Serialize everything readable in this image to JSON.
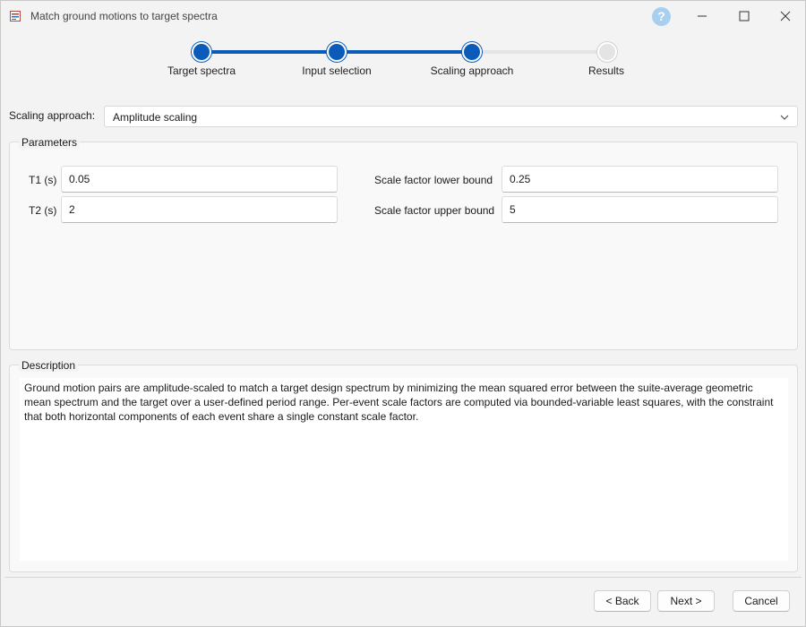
{
  "window": {
    "title": "Match ground motions to target spectra"
  },
  "titlebar": {
    "help_glyph": "?",
    "icons": [
      "app-icon",
      "help-icon",
      "minimize-icon",
      "maximize-icon",
      "close-icon"
    ]
  },
  "stepper": {
    "steps": [
      {
        "label": "Target spectra",
        "state": "complete"
      },
      {
        "label": "Input selection",
        "state": "complete"
      },
      {
        "label": "Scaling approach",
        "state": "current"
      },
      {
        "label": "Results",
        "state": "pending"
      }
    ],
    "active_color": "#0b5cba",
    "inactive_color": "#e4e4e4"
  },
  "scaling": {
    "label": "Scaling approach:",
    "value": "Amplitude scaling"
  },
  "parameters": {
    "title": "Parameters",
    "t1": {
      "label": "T1 (s)",
      "value": "0.05"
    },
    "t2": {
      "label": "T2 (s)",
      "value": "2"
    },
    "lower": {
      "label": "Scale factor lower bound",
      "value": "0.25"
    },
    "upper": {
      "label": "Scale factor upper bound",
      "value": "5"
    }
  },
  "description": {
    "title": "Description",
    "text": "Ground motion pairs are amplitude-scaled to match a target design spectrum by minimizing the mean squared error between the suite-average geometric mean spectrum and the target over a user-defined period range. Per-event scale factors are computed via bounded-variable least squares, with the constraint that both horizontal components of each event share a single constant scale factor."
  },
  "footer": {
    "back": "< Back",
    "next": "Next >",
    "cancel": "Cancel"
  }
}
